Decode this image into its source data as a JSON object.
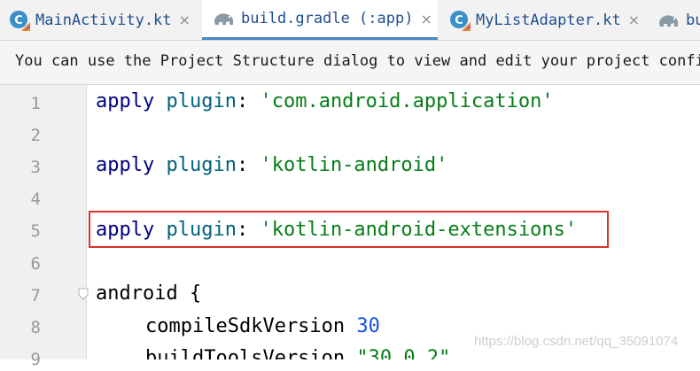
{
  "tabs": [
    {
      "label": "MainActivity.kt",
      "icon": "kotlin-class-icon",
      "active": false
    },
    {
      "label": "build.gradle (:app)",
      "icon": "gradle-elephant-icon",
      "active": true
    },
    {
      "label": "MyListAdapter.kt",
      "icon": "kotlin-class-icon",
      "active": false
    },
    {
      "label": "bu",
      "icon": "gradle-elephant-icon",
      "active": false
    }
  ],
  "tab_close_glyph": "×",
  "notice": {
    "text": "You can use the Project Structure dialog to view and edit your project configu"
  },
  "line_numbers": [
    "1",
    "2",
    "3",
    "4",
    "5",
    "6",
    "7",
    "8",
    "9"
  ],
  "code": {
    "line1": {
      "kw": "apply",
      "plugin": "plugin",
      "colon": ": ",
      "value": "'com.android.application'"
    },
    "line3": {
      "kw": "apply",
      "plugin": "plugin",
      "colon": ": ",
      "value": "'kotlin-android'"
    },
    "line5": {
      "kw": "apply",
      "plugin": "plugin",
      "colon": ": ",
      "value": "'kotlin-android-extensions'"
    },
    "line7": {
      "text": "android {"
    },
    "line8": {
      "key": "compileSdkVersion",
      "value": "30"
    },
    "line9": {
      "key": "buildToolsVersion",
      "value": "\"30.0.2\""
    }
  },
  "watermark": "https://blog.csdn.net/qq_35091074",
  "colors": {
    "highlight_border": "#e0312b",
    "active_tab_underline": "#4a86c7",
    "string": "#067d17",
    "number": "#1750eb"
  }
}
